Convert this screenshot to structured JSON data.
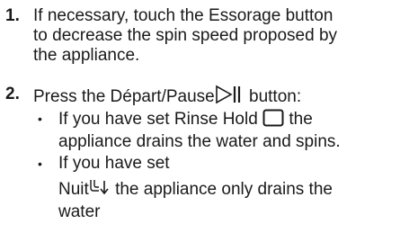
{
  "steps": [
    {
      "number": "1.",
      "line1": "If necessary, touch the Essorage button",
      "line2": "to decrease the spin speed proposed by",
      "line3": "the appliance."
    },
    {
      "number": "2.",
      "text_before": "Press the Départ/Pause",
      "text_after": "button:"
    }
  ],
  "bullets": [
    {
      "marker": "•",
      "line1_before": "If you have set Rinse Hold",
      "line1_after": "the",
      "line2": "appliance drains the water and spins."
    },
    {
      "marker": "•",
      "line1": "If you have set",
      "line2_before": "Nuit",
      "line2_after": "the appliance only drains the",
      "line3": "water"
    }
  ],
  "icons": {
    "play_pause": "play-pause-icon",
    "rinse_hold": "rinse-hold-icon",
    "night": "night-icon"
  }
}
